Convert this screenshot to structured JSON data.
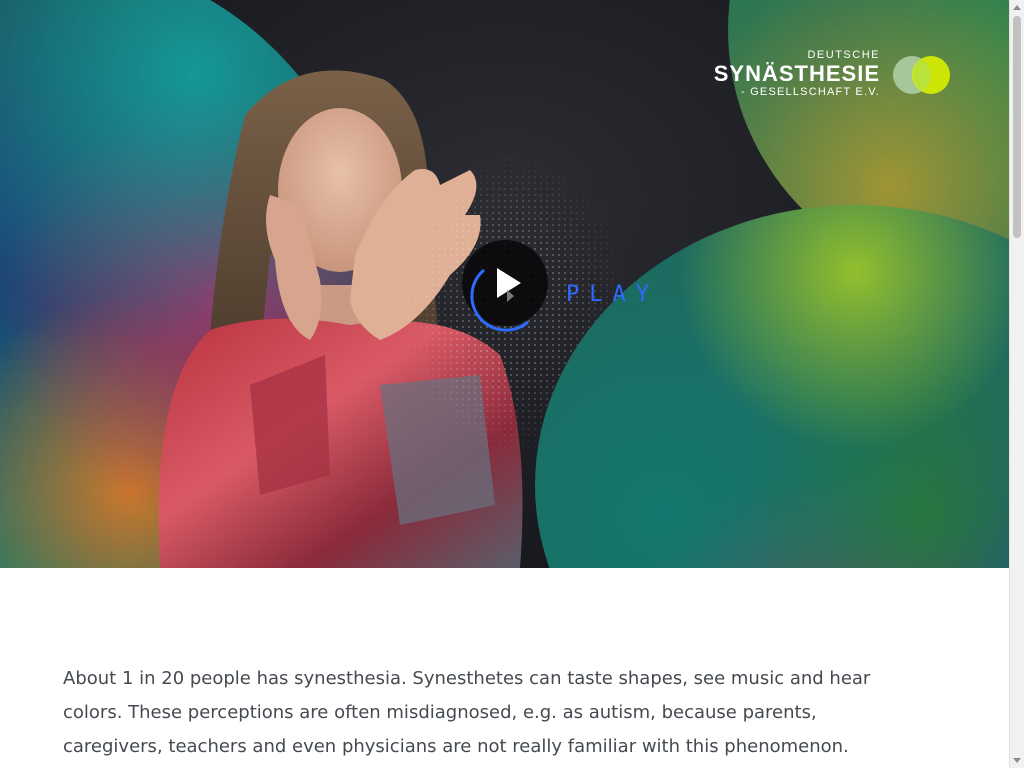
{
  "hero": {
    "logo": {
      "line_top": "DEUTSCHE",
      "line_main": "SYNÄSTHESIE",
      "line_bottom": "- GESELLSCHAFT E.V.",
      "mark_colors": [
        "#a7c79a",
        "#d8f000"
      ]
    },
    "video": {
      "play_label": "PLAY",
      "play_icon": "play-triangle-icon",
      "accent": "#2e6bff"
    }
  },
  "main": {
    "intro_text": "About 1 in 20 people has synesthesia. Synesthetes can taste shapes, see music and hear colors. These perceptions are often misdiagnosed, e.g. as autism, because parents, caregivers, teachers and even physicians are not really familiar with this phenomenon."
  },
  "colors": {
    "text": "#444a50",
    "hero_background": "#1a1b20"
  }
}
